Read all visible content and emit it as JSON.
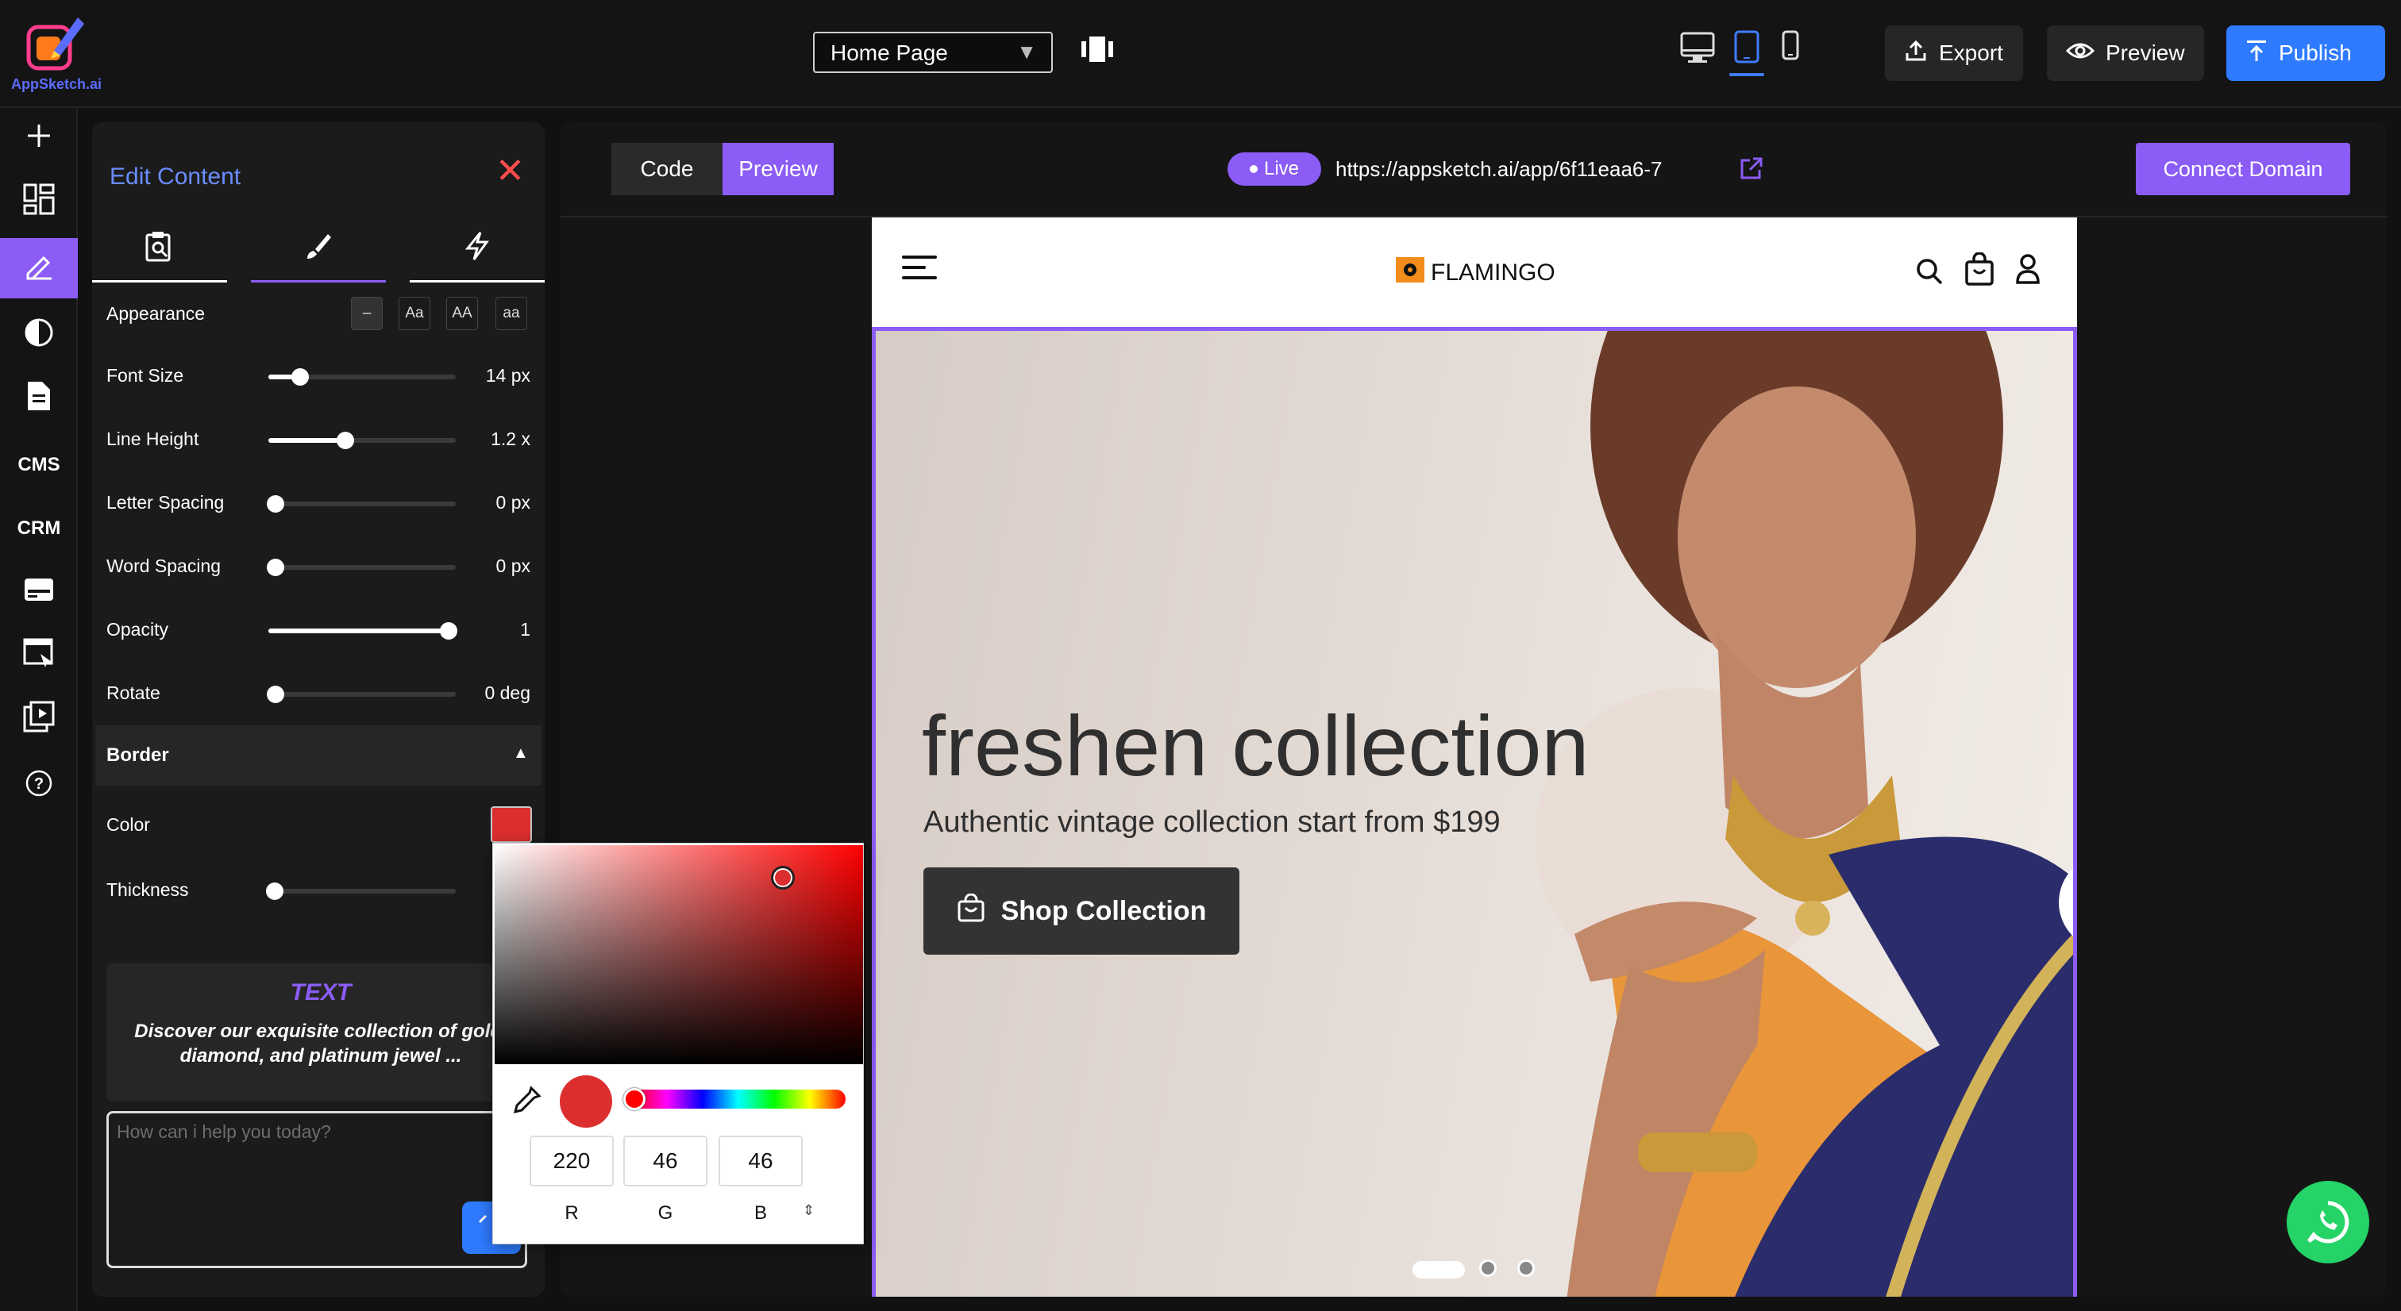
{
  "app": {
    "name": "AppSketch.ai"
  },
  "topbar": {
    "page_select": "Home Page",
    "export_label": "Export",
    "preview_label": "Preview",
    "publish_label": "Publish",
    "active_device": "tablet"
  },
  "rail": {
    "cms_label": "CMS",
    "crm_label": "CRM"
  },
  "edit_panel": {
    "title": "Edit Content",
    "appearance": {
      "label": "Appearance",
      "options": [
        "–",
        "Aa",
        "AA",
        "aa"
      ]
    },
    "properties": [
      {
        "label": "Font Size",
        "value": "14 px",
        "level": 0.17
      },
      {
        "label": "Line Height",
        "value": "1.2 x",
        "level": 0.41
      },
      {
        "label": "Letter Spacing",
        "value": "0 px",
        "level": 0.04
      },
      {
        "label": "Word Spacing",
        "value": "0 px",
        "level": 0.04
      },
      {
        "label": "Opacity",
        "value": "1",
        "level": 0.96
      },
      {
        "label": "Rotate",
        "value": "0 deg",
        "level": 0.04
      }
    ],
    "border": {
      "header": "Border",
      "color_label": "Color",
      "thickness_label": "Thickness",
      "color": "#dc2e2e"
    },
    "text_card": {
      "title": "TEXT",
      "body": "Discover our exquisite collection of gold, diamond, and platinum jewel ..."
    },
    "chat_placeholder": "How can i help you today?"
  },
  "color_picker": {
    "r": "220",
    "g": "46",
    "b": "46",
    "r_label": "R",
    "g_label": "G",
    "b_label": "B"
  },
  "canvas": {
    "code_label": "Code",
    "preview_label": "Preview",
    "live_label": "Live",
    "url": "https://appsketch.ai/app/6f11eaa6-7",
    "connect_label": "Connect Domain"
  },
  "site": {
    "brand": "FLAMINGO",
    "hero_title": "freshen collection",
    "hero_subtitle": "Authentic vintage collection start from $199",
    "cta_label": "Shop Collection",
    "slide_count": 3,
    "active_slide": 1
  },
  "colors": {
    "accent": "#8b5cf6",
    "blue": "#2f7bff",
    "whatsapp": "#25d366",
    "picker_color": "#dc2e2e"
  }
}
